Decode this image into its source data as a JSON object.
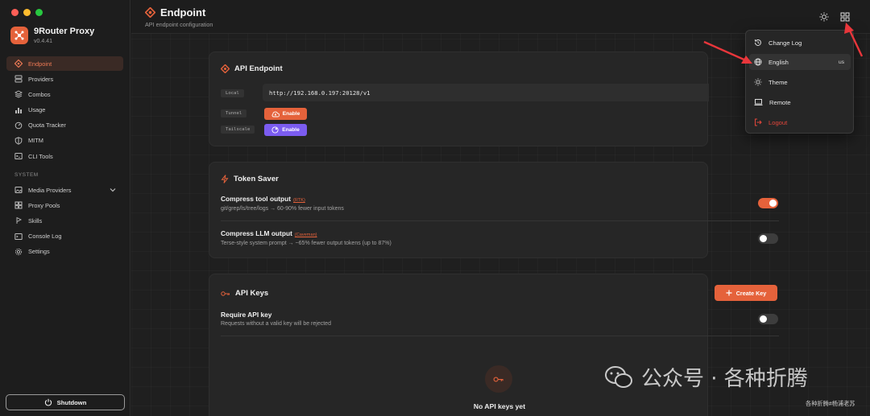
{
  "app": {
    "name": "9Router Proxy",
    "version": "v0.4.41"
  },
  "sidebar": {
    "items": [
      {
        "label": "Endpoint",
        "icon": "endpoint-icon"
      },
      {
        "label": "Providers",
        "icon": "server-icon"
      },
      {
        "label": "Combos",
        "icon": "layers-icon"
      },
      {
        "label": "Usage",
        "icon": "bar-chart-icon"
      },
      {
        "label": "Quota Tracker",
        "icon": "gauge-icon"
      },
      {
        "label": "MITM",
        "icon": "shield-icon"
      },
      {
        "label": "CLI Tools",
        "icon": "terminal-icon"
      }
    ],
    "system_label": "SYSTEM",
    "system_items": [
      {
        "label": "Media Providers",
        "icon": "media-icon"
      },
      {
        "label": "Proxy Pools",
        "icon": "pool-icon"
      },
      {
        "label": "Skills",
        "icon": "skills-icon"
      },
      {
        "label": "Console Log",
        "icon": "console-icon"
      },
      {
        "label": "Settings",
        "icon": "gear-icon"
      }
    ],
    "shutdown_label": "Shutdown"
  },
  "header": {
    "title": "Endpoint",
    "subtitle": "API endpoint configuration"
  },
  "api_endpoint": {
    "title": "API Endpoint",
    "local_label": "Local",
    "local_url": "http://192.168.0.197:20128/v1",
    "tunnel_label": "Tunnel",
    "tailscale_label": "Tailscale",
    "enable_label": "Enable"
  },
  "token_saver": {
    "title": "Token Saver",
    "compress_tool": {
      "title": "Compress tool output",
      "tag": "(RTK)",
      "desc": "git/grep/ls/tree/logs → 60-90% fewer input tokens",
      "enabled": true
    },
    "compress_llm": {
      "title": "Compress LLM output",
      "tag": "(Caveman)",
      "desc": "Terse-style system prompt → ~65% fewer output tokens (up to 87%)",
      "enabled": false
    }
  },
  "api_keys": {
    "title": "API Keys",
    "create_label": "Create Key",
    "require_title": "Require API key",
    "require_desc": "Requests without a valid key will be rejected",
    "require_enabled": false,
    "empty_text": "No API keys yet"
  },
  "menu": {
    "items": [
      {
        "label": "Change Log",
        "icon": "history-icon"
      },
      {
        "label": "English",
        "icon": "globe-icon",
        "code": "us"
      },
      {
        "label": "Theme",
        "icon": "sun-icon"
      },
      {
        "label": "Remote",
        "icon": "laptop-icon"
      },
      {
        "label": "Logout",
        "icon": "logout-icon"
      }
    ]
  },
  "watermark": {
    "main": "公众号 · 各种折腾",
    "sub": "各种折腾#杨浦老苏"
  },
  "colors": {
    "accent": "#e5623b",
    "purple": "#7b5cf0",
    "danger": "#e5463b"
  }
}
